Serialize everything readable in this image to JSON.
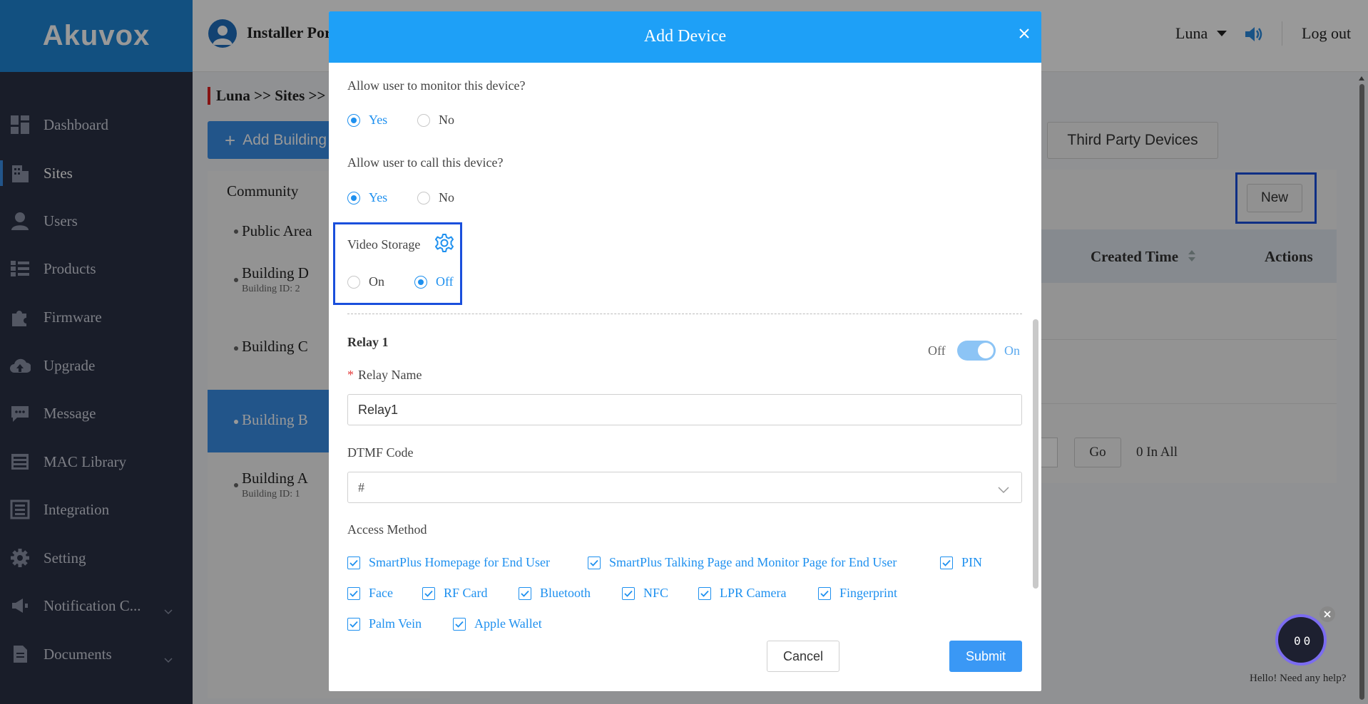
{
  "sidebar": {
    "logo": "Akuvox",
    "items": [
      {
        "label": "Dashboard",
        "icon": "dashboard-icon"
      },
      {
        "label": "Sites",
        "icon": "building-icon"
      },
      {
        "label": "Users",
        "icon": "user-icon"
      },
      {
        "label": "Products",
        "icon": "list-icon"
      },
      {
        "label": "Firmware",
        "icon": "puzzle-icon"
      },
      {
        "label": "Upgrade",
        "icon": "cloud-upload-icon"
      },
      {
        "label": "Message",
        "icon": "chat-icon"
      },
      {
        "label": "MAC Library",
        "icon": "library-icon"
      },
      {
        "label": "Integration",
        "icon": "integration-icon"
      },
      {
        "label": "Setting",
        "icon": "gear-icon"
      },
      {
        "label": "Notification C...",
        "icon": "megaphone-icon"
      },
      {
        "label": "Documents",
        "icon": "document-icon"
      }
    ],
    "active": "Sites"
  },
  "header": {
    "title": "Installer Por",
    "user": "Luna",
    "logout": "Log out"
  },
  "main": {
    "breadcrumb": "Luna >>  Sites >>",
    "add_building": "Add Building",
    "community": "Community",
    "tree": [
      {
        "name": "Public Area",
        "sub": ""
      },
      {
        "name": "Building D",
        "sub": "Building ID: 2"
      },
      {
        "name": "Building C",
        "sub": ""
      },
      {
        "name": "Building B",
        "sub": ""
      },
      {
        "name": "Building A",
        "sub": "Building ID: 1"
      }
    ],
    "third_party": "Third Party Devices",
    "new_label": "New",
    "created_time": "Created Time",
    "actions": "Actions",
    "go": "Go",
    "total": "0 In All"
  },
  "modal": {
    "title": "Add Device",
    "monitor_question": "Allow user to monitor this device?",
    "monitor_yes": "Yes",
    "monitor_no": "No",
    "monitor_selected": "Yes",
    "call_question": "Allow user to call this device?",
    "call_yes": "Yes",
    "call_no": "No",
    "call_selected": "Yes",
    "video_storage_label": "Video Storage",
    "video_on": "On",
    "video_off": "Off",
    "video_selected": "Off",
    "relay_title": "Relay 1",
    "relay_toggle_off": "Off",
    "relay_toggle_on": "On",
    "relay_enabled": true,
    "relay_name_label": "Relay Name",
    "relay_name_required": "*",
    "relay_name_value": "Relay1",
    "dtmf_label": "DTMF Code",
    "dtmf_value": "#",
    "access_label": "Access Method",
    "access_methods": [
      "SmartPlus Homepage for End User",
      "SmartPlus Talking Page and Monitor Page for End User",
      "PIN",
      "Face",
      "RF Card",
      "Bluetooth",
      "NFC",
      "LPR Camera",
      "Fingerprint",
      "Palm Vein",
      "Apple Wallet"
    ],
    "cancel": "Cancel",
    "submit": "Submit"
  },
  "bot": {
    "help": "Hello! Need any help?",
    "face": "00"
  },
  "colors": {
    "sidebar_bg": "#2b3145",
    "brand": "#1e86d6",
    "modal_header": "#1ea0f7",
    "accent": "#1e90ef",
    "highlight": "#1a4fdc"
  }
}
